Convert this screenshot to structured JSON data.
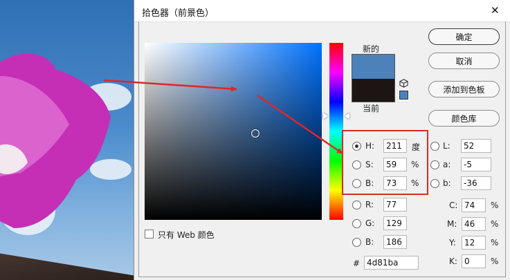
{
  "dialog": {
    "title": "拾色器（前景色）",
    "close_symbol": "✕"
  },
  "swatches": {
    "new_label": "新的",
    "current_label": "当前",
    "new_color": "#4d81ba",
    "current_color": "#1c1514"
  },
  "buttons": {
    "ok": "确定",
    "cancel": "取消",
    "add_to_swatches": "添加到色板",
    "color_libraries": "颜色库"
  },
  "hsb": {
    "h_label": "H:",
    "h_value": "211",
    "h_unit": "度",
    "s_label": "S:",
    "s_value": "59",
    "s_unit": "%",
    "b_label": "B:",
    "b_value": "73",
    "b_unit": "%"
  },
  "rgb": {
    "r_label": "R:",
    "r_value": "77",
    "g_label": "G:",
    "g_value": "129",
    "b_label": "B:",
    "b_value": "186"
  },
  "lab": {
    "l_label": "L:",
    "l_value": "52",
    "a_label": "a:",
    "a_value": "-5",
    "b_label": "b:",
    "b_value": "-36"
  },
  "cmyk": {
    "c_label": "C:",
    "c_value": "74",
    "m_label": "M:",
    "m_value": "46",
    "y_label": "Y:",
    "y_value": "12",
    "k_label": "K:",
    "k_value": "0",
    "unit": "%"
  },
  "hex": {
    "label": "#",
    "value": "4d81ba"
  },
  "web_only": {
    "label": "只有 Web 颜色",
    "checked": false
  },
  "colors": {
    "annotation": "#e0262a",
    "accent": "#4d81ba"
  }
}
